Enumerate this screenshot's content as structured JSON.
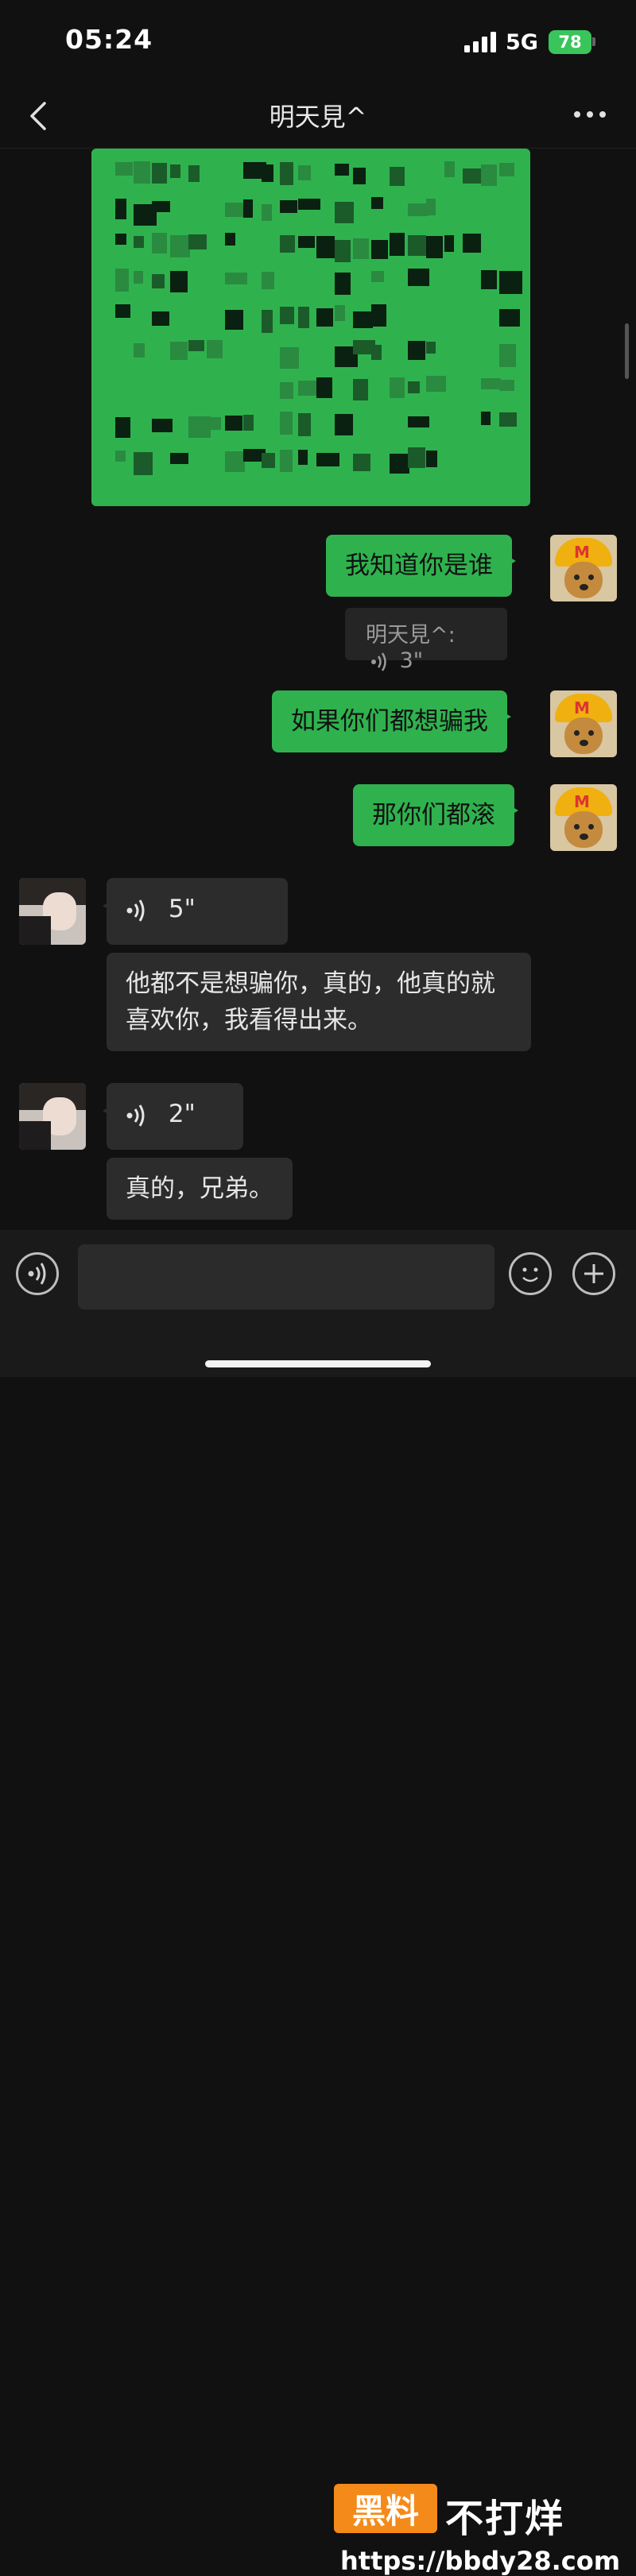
{
  "status": {
    "time": "05:24",
    "network": "5G",
    "battery": "78"
  },
  "nav": {
    "title": "明天見^"
  },
  "messages": {
    "m1": "我知道你是谁",
    "t1_name": "明天見^:",
    "t1_duration": "3\"",
    "m2": "如果你们都想骗我",
    "m3": "那你们都滚",
    "v1_duration": "5\"",
    "m4": "他都不是想骗你，真的，他真的就喜欢你，我看得出来。",
    "v2_duration": "2\"",
    "m5": "真的，兄弟。"
  },
  "watermark": {
    "badge": "黑料",
    "text": "不打烊",
    "url": "https://bbdy28.com"
  },
  "colors": {
    "background": "#111111",
    "my_bubble": "#2fb24e",
    "other_bubble": "#2c2c2c",
    "battery": "#39c55b",
    "watermark_badge": "#f48a1a"
  },
  "icons": [
    "back-icon",
    "more-icon",
    "voice-icon",
    "emoji-icon",
    "plus-icon",
    "signal-icon"
  ]
}
